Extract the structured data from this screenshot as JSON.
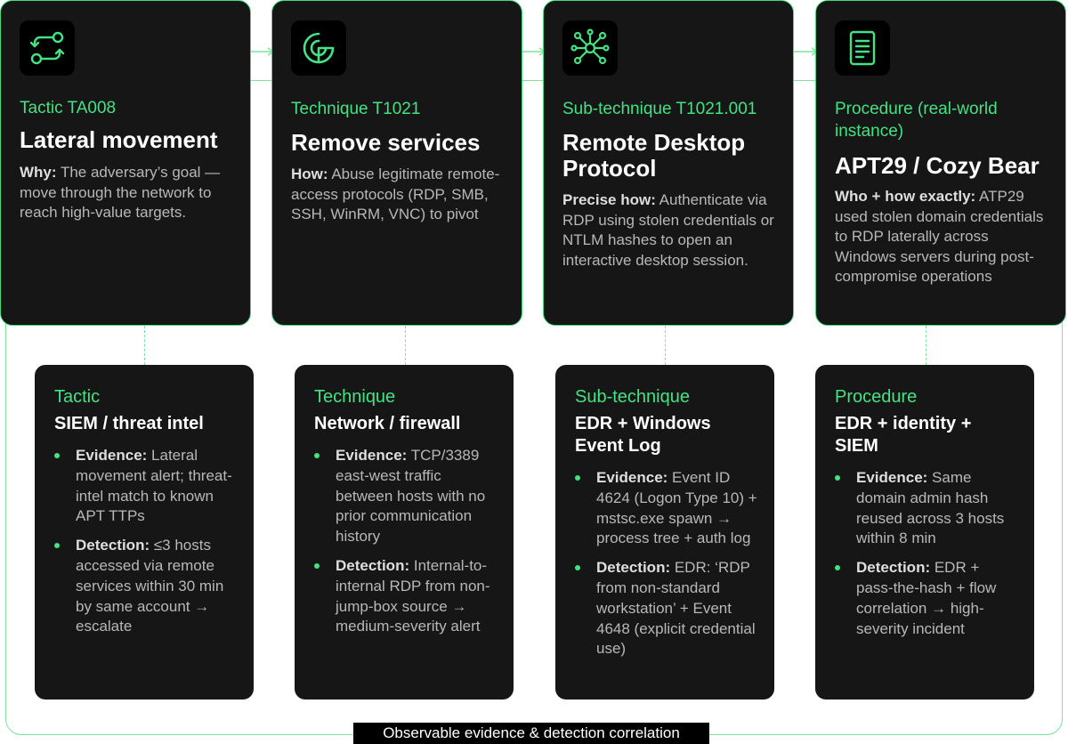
{
  "top": [
    {
      "level": "Tactic TA008",
      "title": "Lateral movement",
      "desc_label": "Why:",
      "desc": " The adversary’s goal — move through  the network to reach high-value targets."
    },
    {
      "level": "Technique T1021",
      "title": "Remove services",
      "desc_label": "How:",
      "desc": " Abuse legitimate remote-access protocols (RDP, SMB, SSH, WinRM, VNC) to pivot"
    },
    {
      "level": "Sub-technique T1021.001",
      "title": "Remote Desktop Protocol",
      "desc_label": "Precise how:",
      "desc": " Authenticate via RDP using stolen credentials or NTLM hashes to open an interactive desktop session."
    },
    {
      "level": "Procedure (real-world instance)",
      "title": "APT29 / Cozy Bear",
      "desc_label": "Who + how exactly:",
      "desc": " ATP29 used stolen domain credentials to RDP laterally across Windows servers during post-compromise operations"
    }
  ],
  "bottom": [
    {
      "level": "Tactic",
      "title": "SIEM / threat intel",
      "items": [
        {
          "label": "Evidence:",
          "text": " Lateral movement alert; threat-intel match to known APT TTPs"
        },
        {
          "label": "Detection:",
          "text": " ≤3 hosts accessed via remote services within 30 min by same account → escalate"
        }
      ]
    },
    {
      "level": "Technique",
      "title": "Network / firewall",
      "items": [
        {
          "label": "Evidence:",
          "text": " TCP/3389 east-west traffic between hosts with no prior communication history"
        },
        {
          "label": "Detection:",
          "text": " Internal-to-internal RDP from non-jump-box source → medium-severity alert"
        }
      ]
    },
    {
      "level": "Sub-technique",
      "title": "EDR + Windows Event Log",
      "items": [
        {
          "label": "Evidence:",
          "text": " Event ID 4624 (Logon Type 10) + mstsc.exe spawn → process tree +  auth log"
        },
        {
          "label": "Detection:",
          "text": " EDR: ‘RDP from non-standard workstation’ + Event 4648 (explicit credential use)"
        }
      ]
    },
    {
      "level": "Procedure",
      "title": "EDR + identity + SIEM",
      "items": [
        {
          "label": "Evidence:",
          "text": " Same domain admin hash reused across 3 hosts within 8 min"
        },
        {
          "label": "Detection:",
          "text": " EDR + pass-the-hash + flow correlation → high-severity incident"
        }
      ]
    }
  ],
  "caption": "Observable evidence & detection correlation",
  "icons": [
    "transfer-arrows-icon",
    "target-radar-icon",
    "network-hub-icon",
    "document-icon"
  ],
  "colors": {
    "accent": "#43e283",
    "card": "#161616",
    "border": "#7be39c"
  }
}
